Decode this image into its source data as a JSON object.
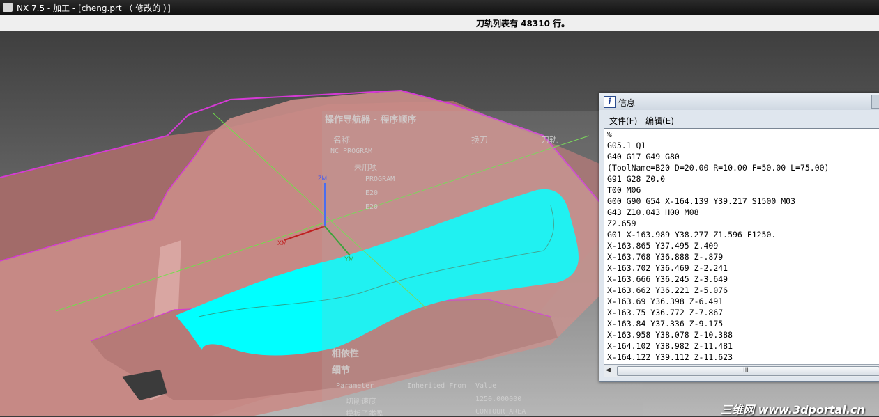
{
  "window": {
    "title": "NX 7.5 - 加工 - [cheng.prt （ 修改的 ）]"
  },
  "status": {
    "message": "刀轨列表有 48310 行。"
  },
  "colors": {
    "part": "#c98c88",
    "part_edge": "#d63ad6",
    "toolpath_surface": "#00ffff",
    "axis_line": "#6fe04a",
    "viewport_top": "#3f3f3f",
    "info_caption": "#dfe6ee"
  },
  "navigator": {
    "title": "操作导航器 - 程序顺序",
    "columns": [
      "名称",
      "换刀",
      "刀轨"
    ],
    "nodes": [
      "NC_PROGRAM",
      "未用项",
      "PROGRAM",
      "E20",
      "E20"
    ],
    "sections": [
      "相依性",
      "细节"
    ],
    "param_columns": [
      "Parameter",
      "Inherited From",
      "Value"
    ],
    "params": [
      {
        "name": "切削速度",
        "value": "1250.000000"
      },
      {
        "name": "模板子类型",
        "value": "CONTOUR_AREA"
      }
    ]
  },
  "axes": {
    "zm": "ZM",
    "xm": "XM",
    "ym": "YM"
  },
  "info_window": {
    "title": "信息",
    "menu": [
      "文件(F)",
      "编辑(E)"
    ],
    "icon": "info-i-icon",
    "lines": [
      "%",
      "G05.1 Q1",
      "G40 G17 G49 G80",
      "(ToolName=B20 D=20.00 R=10.00 F=50.00 L=75.00)",
      "G91 G28 Z0.0",
      "T00 M06",
      "G00 G90 G54 X-164.139 Y39.217 S1500 M03",
      "G43 Z10.043 H00 M08",
      "Z2.659",
      "G01 X-163.989 Y38.277 Z1.596 F1250.",
      "X-163.865 Y37.495 Z.409",
      "X-163.768 Y36.888 Z-.879",
      "X-163.702 Y36.469 Z-2.241",
      "X-163.666 Y36.245 Z-3.649",
      "X-163.662 Y36.221 Z-5.076",
      "X-163.69 Y36.398 Z-6.491",
      "X-163.75 Y36.772 Z-7.867",
      "X-163.84 Y37.336 Z-9.175",
      "X-163.958 Y38.078 Z-10.388",
      "X-164.102 Y38.982 Z-11.481",
      "X-164.122 Y39.112 Z-11.623"
    ],
    "scroll_grip": "III"
  },
  "watermark": "三维网 www.3dportal.cn"
}
